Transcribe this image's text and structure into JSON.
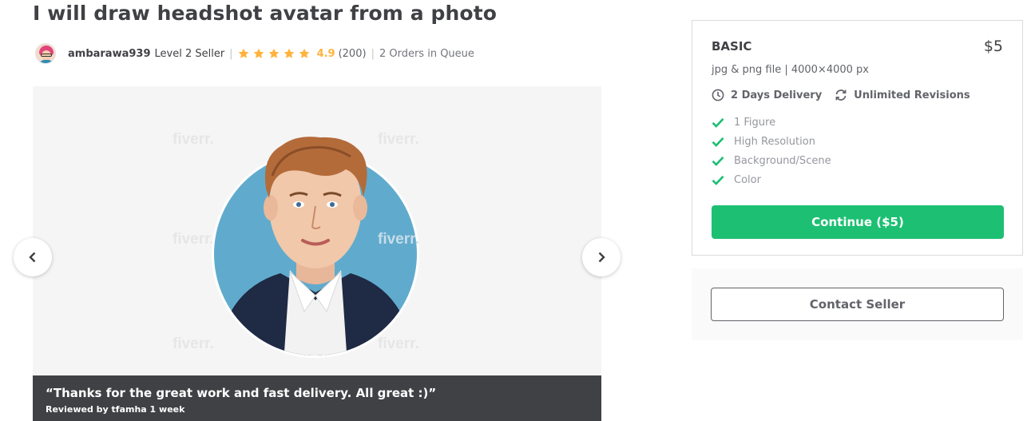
{
  "gig": {
    "title": "I will draw headshot avatar from a photo"
  },
  "seller": {
    "username": "ambarawa939",
    "level": "Level 2 Seller",
    "separator": "|",
    "rating": "4.9",
    "star_count": 5,
    "reviews": "(200)",
    "queue": "2 Orders in Queue"
  },
  "gallery": {
    "watermark": "fiverr.",
    "review_quote": "“Thanks for the great work and fast delivery. All great :)”",
    "reviewer_line": "Reviewed by tfamha 1 week",
    "prev_icon": "chevron-left-icon",
    "next_icon": "chevron-right-icon"
  },
  "package": {
    "name": "BASIC",
    "price": "$5",
    "description": "jpg & png file | 4000×4000 px",
    "delivery": "2 Days Delivery",
    "revisions": "Unlimited Revisions",
    "features": [
      "1 Figure",
      "High Resolution",
      "Background/Scene",
      "Color"
    ],
    "continue_label": "Continue ($5)"
  },
  "contact": {
    "label": "Contact Seller"
  },
  "colors": {
    "brand_green": "#1dbf73",
    "star_yellow": "#ffb33e",
    "text_dark": "#404145",
    "caption_bg": "#404145"
  }
}
